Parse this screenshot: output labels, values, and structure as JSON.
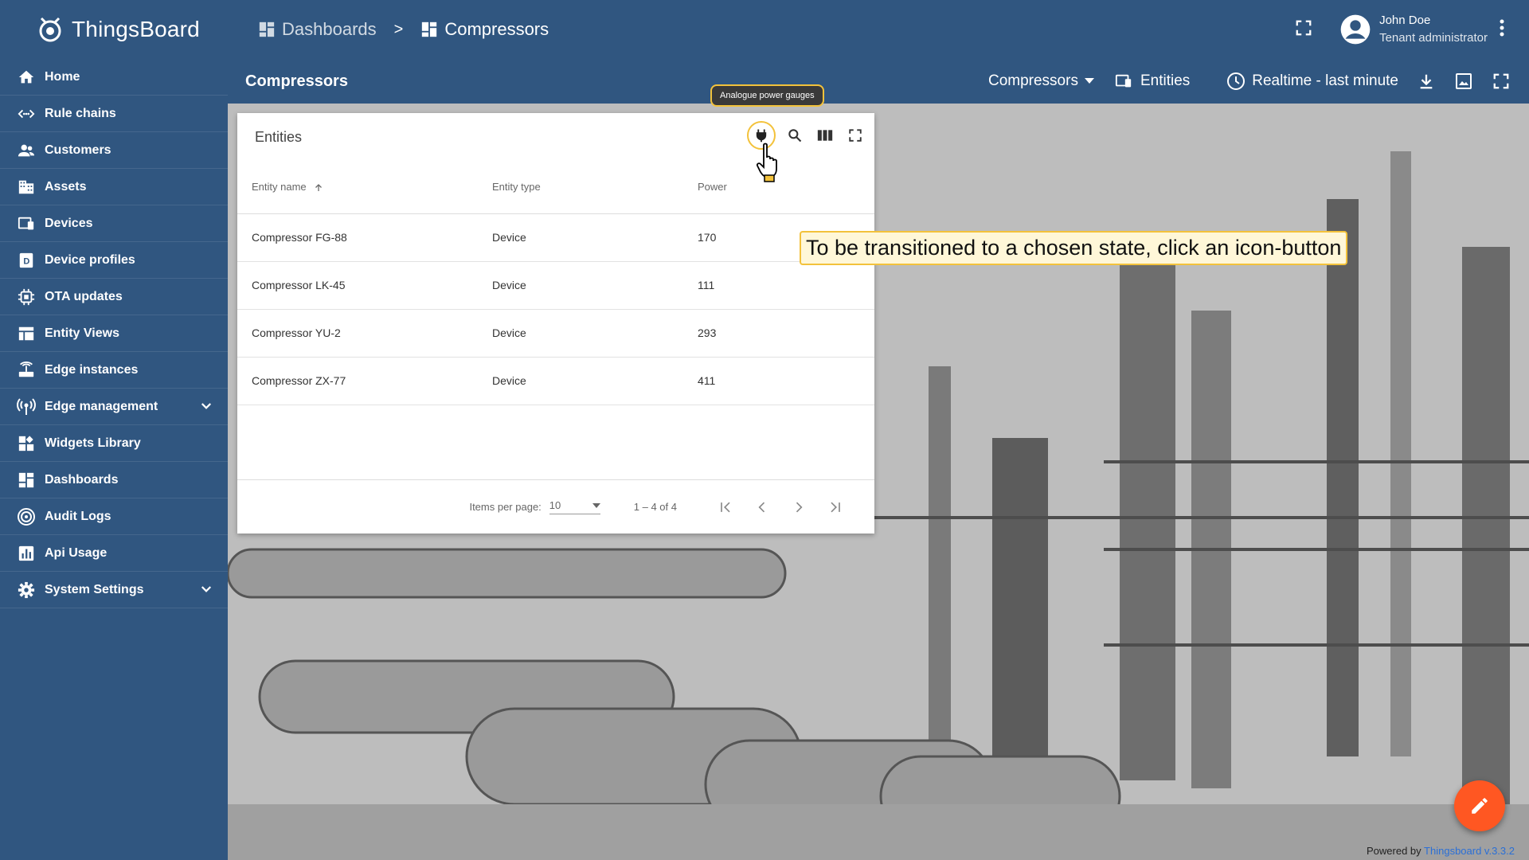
{
  "app": {
    "name": "ThingsBoard"
  },
  "sidebar": {
    "items": [
      {
        "label": "Home",
        "icon": "home-icon"
      },
      {
        "label": "Rule chains",
        "icon": "rule-chain-icon"
      },
      {
        "label": "Customers",
        "icon": "customers-icon"
      },
      {
        "label": "Assets",
        "icon": "assets-icon"
      },
      {
        "label": "Devices",
        "icon": "devices-icon"
      },
      {
        "label": "Device profiles",
        "icon": "device-profile-icon"
      },
      {
        "label": "OTA updates",
        "icon": "ota-icon"
      },
      {
        "label": "Entity Views",
        "icon": "entity-views-icon"
      },
      {
        "label": "Edge instances",
        "icon": "edge-icon"
      },
      {
        "label": "Edge management",
        "icon": "edge-management-icon"
      },
      {
        "label": "Widgets Library",
        "icon": "widgets-icon"
      },
      {
        "label": "Dashboards",
        "icon": "dashboards-icon"
      },
      {
        "label": "Audit Logs",
        "icon": "audit-icon"
      },
      {
        "label": "Api Usage",
        "icon": "api-usage-icon"
      },
      {
        "label": "System Settings",
        "icon": "settings-icon"
      }
    ]
  },
  "breadcrumb": {
    "first": "Dashboards",
    "separator": ">",
    "current": "Compressors"
  },
  "user": {
    "name": "John Doe",
    "role": "Tenant administrator"
  },
  "dashboard": {
    "title": "Compressors",
    "state_label": "Compressors",
    "entities_label": "Entities",
    "timewindow_label": "Realtime - last minute"
  },
  "widget": {
    "title": "Entities",
    "columns": [
      "Entity name",
      "Entity type",
      "Power"
    ],
    "rows": [
      {
        "name": "Compressor FG-88",
        "type": "Device",
        "power": "170"
      },
      {
        "name": "Compressor LK-45",
        "type": "Device",
        "power": "111"
      },
      {
        "name": "Compressor YU-2",
        "type": "Device",
        "power": "293"
      },
      {
        "name": "Compressor ZX-77",
        "type": "Device",
        "power": "411"
      }
    ],
    "pager": {
      "items_label": "Items per page:",
      "items_value": "10",
      "range": "1 – 4 of 4"
    }
  },
  "tooltip": {
    "small": "Analogue power gauges",
    "callout": "To be transitioned to a chosen state, click an icon-button"
  },
  "footer": {
    "prefix": "Powered by",
    "link": "Thingsboard v.3.3.2"
  },
  "colors": {
    "primary": "#305680",
    "accent": "#ff5722",
    "highlight": "#f3c23b"
  }
}
